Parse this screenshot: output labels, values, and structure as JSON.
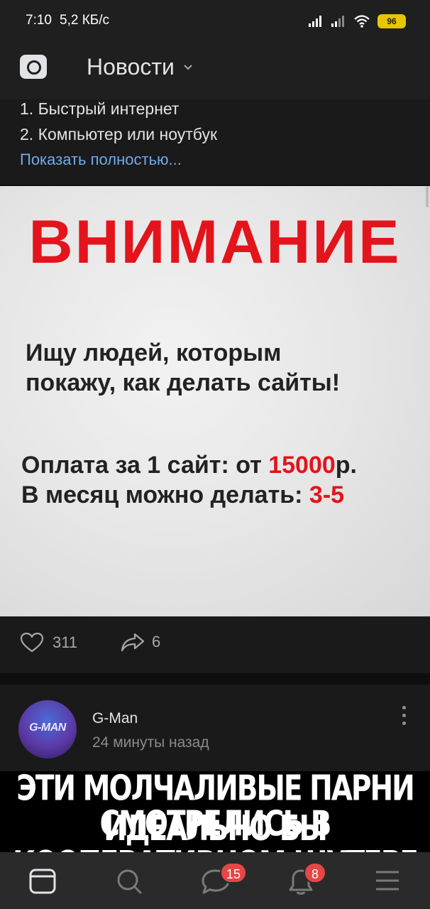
{
  "status_bar": {
    "time": "7:10",
    "speed": "5,2 КБ/с",
    "battery": "96"
  },
  "header": {
    "title": "Новости"
  },
  "post": {
    "lines": [
      "1. Быстрый интернет",
      "2. Компьютер или ноутбук"
    ],
    "show_more": "Показать полностью...",
    "image": {
      "headline": "ВНИМАНИЕ",
      "text_1": "Ищу людей, которым",
      "text_2": "покажу, как делать сайты!",
      "pay_prefix": "Оплата за 1 сайт: от ",
      "pay_value": "15000",
      "pay_suffix": "р.",
      "month_prefix": "В месяц можно делать: ",
      "month_value": "3-5"
    },
    "likes": "311",
    "shares": "6"
  },
  "next_post": {
    "author": "G-Man",
    "time": "24 минуты назад",
    "avatar_text": "G-MAN",
    "meme_line_1": "ЭТИ МОЛЧАЛИВЫЕ ПАРНИ ИДЕАЛЬНО БЫ",
    "meme_line_2": "СМОТРЕЛИСЬ В КООПЕРАТИВНОМ ШУТЕРЕ"
  },
  "bottom_nav": {
    "messages_badge": "15",
    "notifications_badge": "8"
  },
  "colors": {
    "accent_link": "#71aaeb",
    "alert_red": "#e3141b",
    "badge_red": "#e64646",
    "battery_yellow": "#e7c500"
  },
  "icons": [
    "signal-icon",
    "wifi-icon",
    "battery-icon",
    "camera-icon",
    "chevron-down-icon",
    "heart-icon",
    "share-icon",
    "more-icon",
    "feed-icon",
    "search-icon",
    "messages-icon",
    "bell-icon",
    "menu-icon"
  ]
}
